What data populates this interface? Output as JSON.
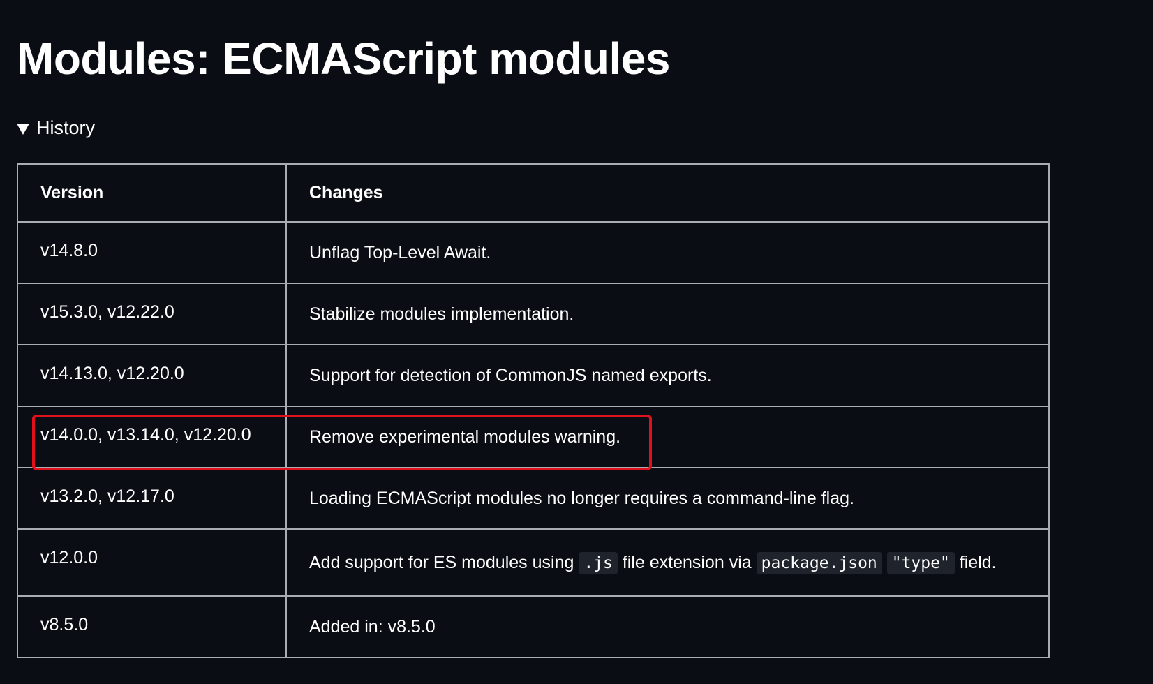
{
  "page": {
    "title": "Modules: ECMAScript modules"
  },
  "history": {
    "toggle_label": "History",
    "columns": {
      "version": "Version",
      "changes": "Changes"
    },
    "rows": [
      {
        "version": "v14.8.0",
        "changes": "Unflag Top-Level Await."
      },
      {
        "version": "v15.3.0, v12.22.0",
        "changes": "Stabilize modules implementation."
      },
      {
        "version": "v14.13.0, v12.20.0",
        "changes": "Support for detection of CommonJS named exports."
      },
      {
        "version": "v14.0.0, v13.14.0, v12.20.0",
        "changes": "Remove experimental modules warning."
      },
      {
        "version": "v13.2.0, v12.17.0",
        "changes": "Loading ECMAScript modules no longer requires a command-line flag."
      },
      {
        "version": "v12.0.0",
        "changes_parts": {
          "text1": "Add support for ES modules using ",
          "code1": ".js",
          "text2": " file extension via ",
          "code2": "package.json",
          "text3": " ",
          "code3": "\"type\"",
          "text4": " field."
        }
      },
      {
        "version": "v8.5.0",
        "changes": "Added in: v8.5.0"
      }
    ]
  },
  "colors": {
    "background": "#0a0d14",
    "text": "#ffffff",
    "table_border": "#a9acb2",
    "highlight": "#e0111b"
  }
}
